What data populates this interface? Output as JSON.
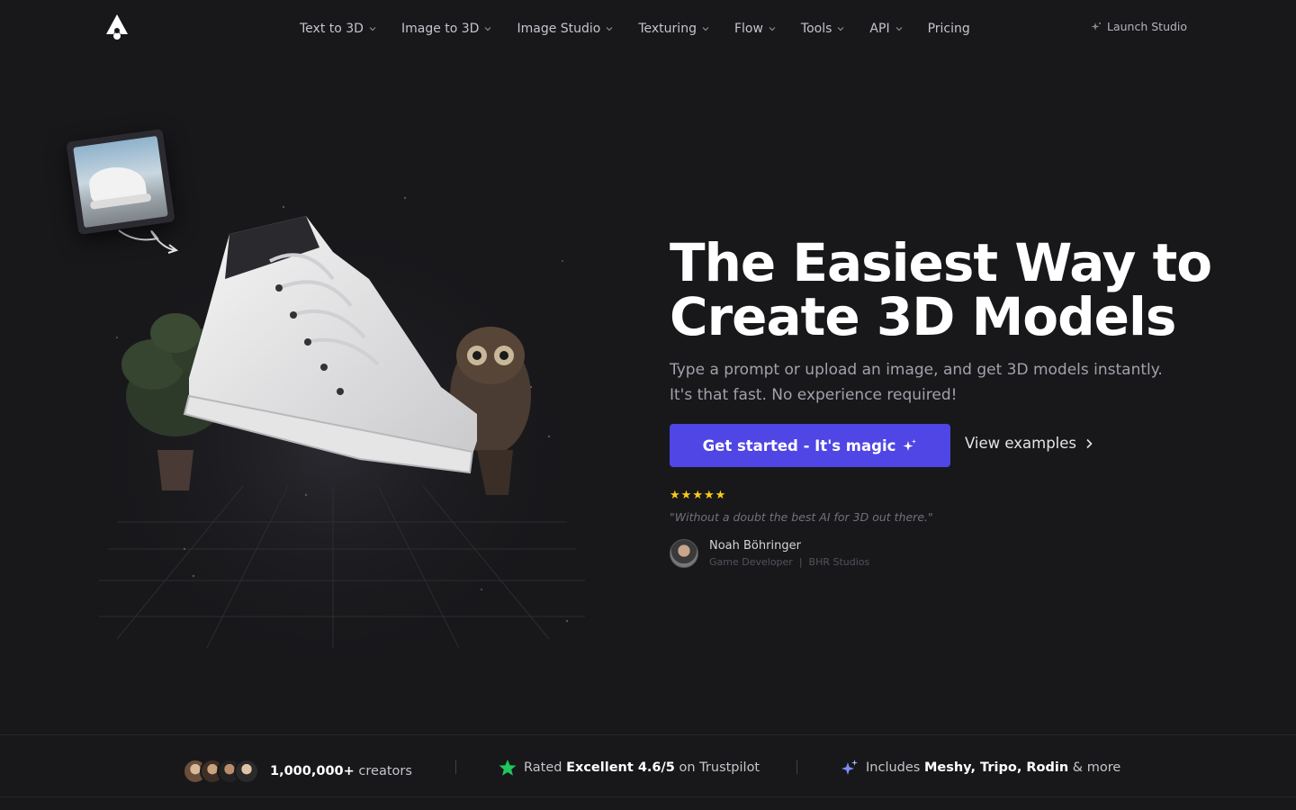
{
  "nav": {
    "items": [
      {
        "label": "Text to 3D",
        "dropdown": true
      },
      {
        "label": "Image to 3D",
        "dropdown": true
      },
      {
        "label": "Image Studio",
        "dropdown": true
      },
      {
        "label": "Texturing",
        "dropdown": true
      },
      {
        "label": "Flow",
        "dropdown": true
      },
      {
        "label": "Tools",
        "dropdown": true
      },
      {
        "label": "API",
        "dropdown": true
      },
      {
        "label": "Pricing",
        "dropdown": false
      }
    ],
    "launch_label": "Launch Studio"
  },
  "hero": {
    "headline_line1": "The Easiest Way to",
    "headline_line2": "Create 3D Models",
    "sub_line1": "Type a prompt or upload an image, and get 3D models instantly.",
    "sub_line2": "It's that fast. No experience required!",
    "cta_label": "Get started - It's magic",
    "examples_label": "View examples",
    "rating_stars": 5,
    "quote": "\"Without a doubt the best AI for 3D out there.\"",
    "person_name": "Noah Böhringer",
    "person_role": "Game Developer",
    "person_company": "BHR Studios",
    "role_separator": "|"
  },
  "strip": {
    "creators_count": "1,000,000+",
    "creators_label": "creators",
    "rated_prefix": "Rated",
    "rated_strong": "Excellent 4.6/5",
    "rated_suffix": "on Trustpilot",
    "includes_prefix": "Includes",
    "includes_strong": "Meshy, Tripo, Rodin",
    "includes_suffix": "& more"
  },
  "colors": {
    "background": "#18181b",
    "accent": "#4f46e5",
    "star": "#facc15",
    "trustpilot": "#22c55e",
    "sparkle": "#818cf8"
  },
  "icons": [
    "logo-icon",
    "chevron-down-icon",
    "sparkle-icon",
    "chevron-right-icon",
    "star-icon",
    "trustpilot-star-icon"
  ]
}
